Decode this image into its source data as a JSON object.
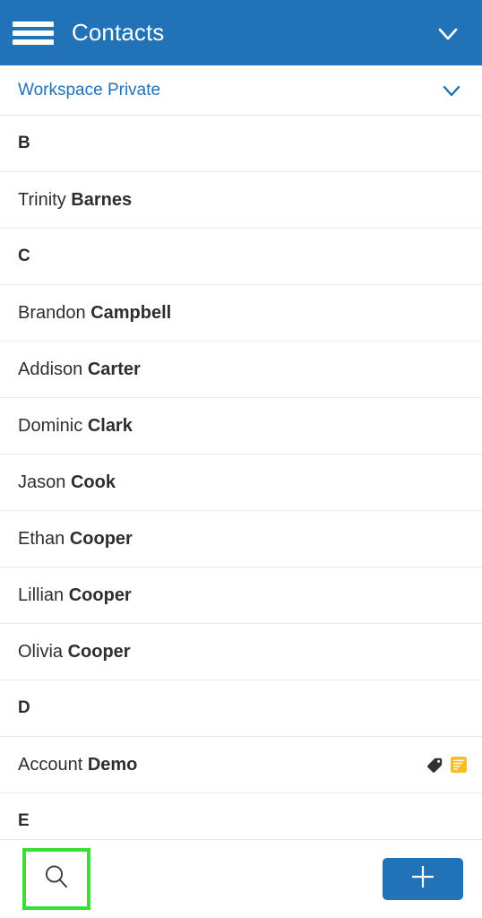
{
  "appbar": {
    "title": "Contacts",
    "menu_icon": "hamburger-menu-icon",
    "confirm_icon": "checkmark-icon",
    "background_color": "#2272b8"
  },
  "workspace": {
    "label": "Workspace Private",
    "chevron_icon": "chevron-down-icon",
    "text_color": "#2272b8"
  },
  "list": {
    "rows": [
      {
        "type": "section",
        "letter": "B"
      },
      {
        "type": "contact",
        "first": "Trinity",
        "last": "Barnes",
        "icons": []
      },
      {
        "type": "section",
        "letter": "C"
      },
      {
        "type": "contact",
        "first": "Brandon",
        "last": "Campbell",
        "icons": []
      },
      {
        "type": "contact",
        "first": "Addison",
        "last": "Carter",
        "icons": []
      },
      {
        "type": "contact",
        "first": "Dominic",
        "last": "Clark",
        "icons": []
      },
      {
        "type": "contact",
        "first": "Jason",
        "last": "Cook",
        "icons": []
      },
      {
        "type": "contact",
        "first": "Ethan",
        "last": "Cooper",
        "icons": []
      },
      {
        "type": "contact",
        "first": "Lillian",
        "last": "Cooper",
        "icons": []
      },
      {
        "type": "contact",
        "first": "Olivia",
        "last": "Cooper",
        "icons": []
      },
      {
        "type": "section",
        "letter": "D"
      },
      {
        "type": "contact",
        "first": "Account",
        "last": "Demo",
        "icons": [
          "tag-icon",
          "note-icon"
        ]
      },
      {
        "type": "section",
        "letter": "E"
      }
    ],
    "tag_icon_color": "#303136",
    "note_icon_color": "#f5bd2a"
  },
  "bottombar": {
    "search_icon": "search-icon",
    "add_icon": "plus-icon",
    "search_highlight_color": "#35e033",
    "add_button_color": "#2272b8"
  }
}
